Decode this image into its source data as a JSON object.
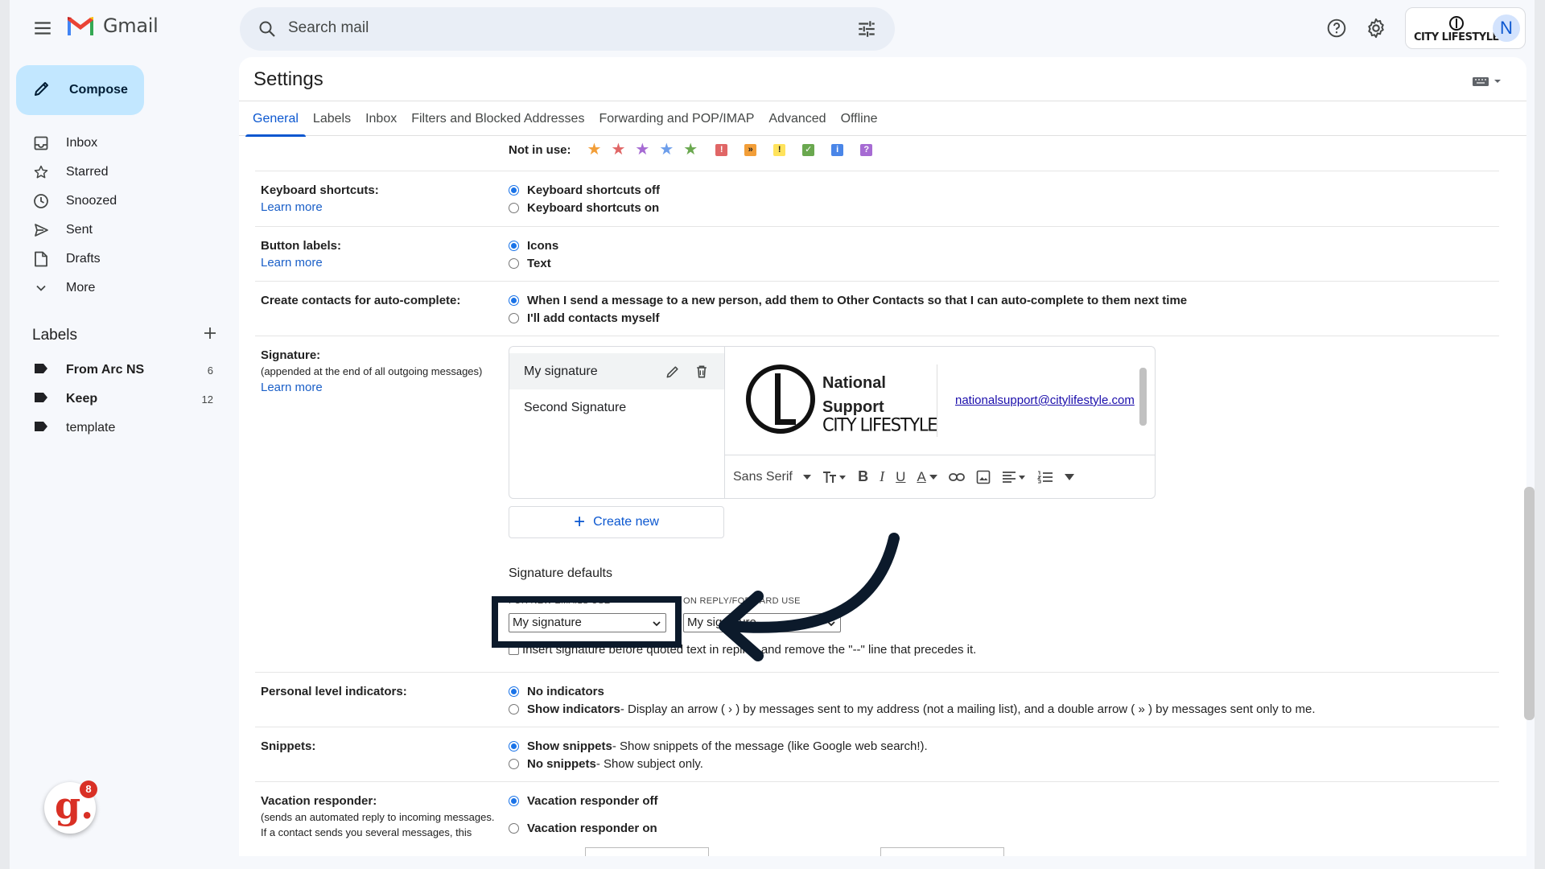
{
  "app": {
    "name": "Gmail"
  },
  "search": {
    "placeholder": "Search mail"
  },
  "account": {
    "brand": "CITY LIFESTYLE",
    "avatar_letter": "N"
  },
  "compose": {
    "label": "Compose"
  },
  "nav": [
    {
      "label": "Inbox",
      "icon": "inbox-icon"
    },
    {
      "label": "Starred",
      "icon": "star-icon"
    },
    {
      "label": "Snoozed",
      "icon": "clock-icon"
    },
    {
      "label": "Sent",
      "icon": "send-icon"
    },
    {
      "label": "Drafts",
      "icon": "draft-icon"
    },
    {
      "label": "More",
      "icon": "chevron-down-icon"
    }
  ],
  "labels": {
    "title": "Labels",
    "items": [
      {
        "label": "From Arc NS",
        "count": "6",
        "bold": true
      },
      {
        "label": "Keep",
        "count": "12",
        "bold": true
      },
      {
        "label": "template",
        "count": "",
        "bold": false
      }
    ]
  },
  "addon": {
    "badge": "8"
  },
  "settings": {
    "title": "Settings",
    "tabs": [
      "General",
      "Labels",
      "Inbox",
      "Filters and Blocked Addresses",
      "Forwarding and POP/IMAP",
      "Advanced",
      "Offline"
    ],
    "active_tab": "General",
    "stars": {
      "label": "Not in use:"
    },
    "keyboard": {
      "label": "Keyboard shortcuts:",
      "learn": "Learn more",
      "opt1": "Keyboard shortcuts off",
      "opt2": "Keyboard shortcuts on"
    },
    "buttons": {
      "label": "Button labels:",
      "learn": "Learn more",
      "opt1": "Icons",
      "opt2": "Text"
    },
    "contacts": {
      "label": "Create contacts for auto-complete:",
      "opt1": "When I send a message to a new person, add them to Other Contacts so that I can auto-complete to them next time",
      "opt2": "I'll add contacts myself"
    },
    "signature": {
      "label": "Signature:",
      "sub": "(appended at the end of all outgoing messages)",
      "learn": "Learn more",
      "items": [
        "My signature",
        "Second Signature"
      ],
      "preview": {
        "line1": "National",
        "line2": "Support",
        "brand": "CITY LIFESTYLE",
        "email": "nationalsupport@citylifestyle.com"
      },
      "font": "Sans Serif",
      "create_new": "Create new",
      "defaults_title": "Signature defaults",
      "new_email_label": "FOR NEW EMAILS USE",
      "reply_label": "ON REPLY/FORWARD USE",
      "new_email_value": "My signature",
      "reply_value": "My signature",
      "insert_before": "Insert signature before quoted text in replies and remove the \"--\" line that precedes it."
    },
    "personal": {
      "label": "Personal level indicators:",
      "opt1": "No indicators",
      "opt2_bold": "Show indicators",
      "opt2_rest": " - Display an arrow ( › ) by messages sent to my address (not a mailing list), and a double arrow ( » ) by messages sent only to me."
    },
    "snippets": {
      "label": "Snippets:",
      "opt1_bold": "Show snippets",
      "opt1_rest": " - Show snippets of the message (like Google web search!).",
      "opt2_bold": "No snippets",
      "opt2_rest": " - Show subject only."
    },
    "vacation": {
      "label": "Vacation responder:",
      "sub1": "(sends an automated reply to incoming messages.",
      "sub2": "If a contact sends you several messages, this",
      "opt1": "Vacation responder off",
      "opt2": "Vacation responder on"
    }
  },
  "colors": {
    "accent": "#0b57d0",
    "compose_bg": "#c2e7ff",
    "highlight": "#0c1a2b"
  }
}
